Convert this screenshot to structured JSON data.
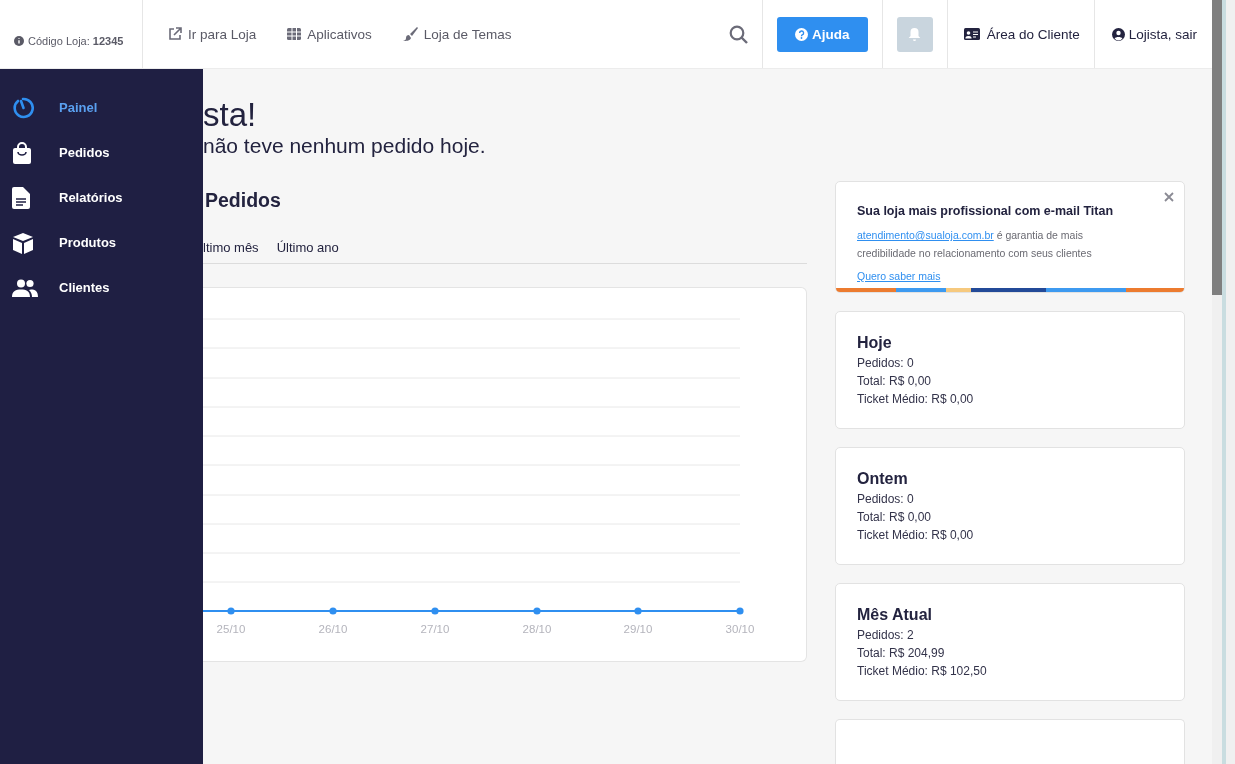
{
  "topbar": {
    "store_code": "Código Loja: **12345**",
    "links": [
      {
        "label": "Ir para Loja"
      },
      {
        "label": "Aplicativos"
      },
      {
        "label": "Loja de Temas"
      }
    ],
    "help_button": "Ajuda",
    "client_area": "Área do Cliente",
    "user": "Lojista, sair"
  },
  "sidebar": {
    "items": [
      {
        "label": "Painel",
        "selected": true
      },
      {
        "label": "Pedidos",
        "selected": false
      },
      {
        "label": "Relatórios",
        "selected": false
      },
      {
        "label": "Produtos",
        "selected": false
      },
      {
        "label": "Clientes",
        "selected": false
      }
    ]
  },
  "main": {
    "greeting": "sta!",
    "subtitle": "não teve nenhum pedido hoje.",
    "section_title": "Pedidos",
    "tabs": [
      {
        "label": "ltimo mês",
        "selected": false
      },
      {
        "label": "Último ano",
        "selected": false
      }
    ],
    "chart_x_labels": [
      "25/10",
      "26/10",
      "27/10",
      "28/10",
      "29/10",
      "30/10"
    ]
  },
  "promo": {
    "title": "Sua loja mais profissional com e-mail Titan",
    "email": "atendimento@sualoja.com.br",
    "text": "é garantia de mais credibilidade no relacionamento com seus clientes",
    "link": "Quero saber mais"
  },
  "stats": [
    {
      "title": "Hoje",
      "lines": [
        "Pedidos: 0",
        "Total: R$ 0,00",
        "Ticket Médio: R$ 0,00"
      ]
    },
    {
      "title": "Ontem",
      "lines": [
        "Pedidos: 0",
        "Total: R$ 0,00",
        "Ticket Médio: R$ 0,00"
      ]
    },
    {
      "title": "Mês Atual",
      "lines": [
        "Pedidos: 2",
        "Total: R$ 204,99",
        "Ticket Médio: R$ 102,50"
      ]
    }
  ]
}
